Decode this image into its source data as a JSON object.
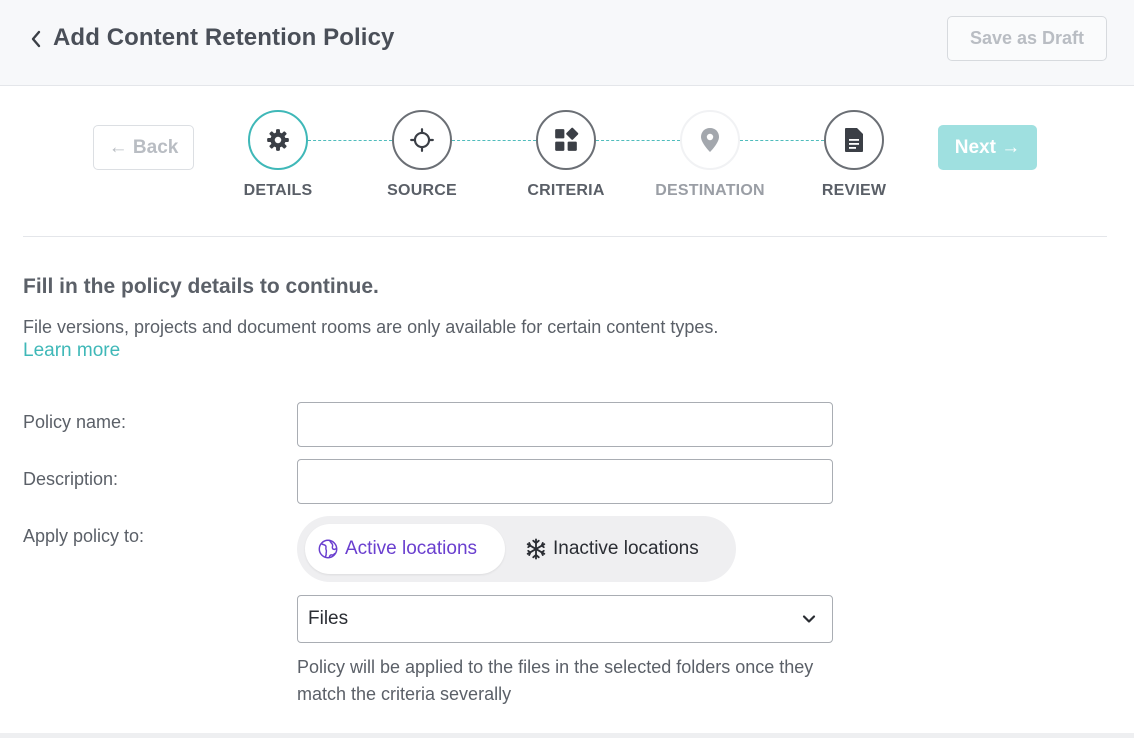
{
  "header": {
    "title": "Add Content Retention Policy",
    "save_draft_label": "Save as Draft"
  },
  "wizard": {
    "back_label": "← Back",
    "next_label": "Next →",
    "steps": [
      {
        "label": "DETAILS",
        "icon": "gear-icon",
        "state": "active"
      },
      {
        "label": "SOURCE",
        "icon": "crosshair-icon",
        "state": "default"
      },
      {
        "label": "CRITERIA",
        "icon": "grid-icon",
        "state": "default"
      },
      {
        "label": "DESTINATION",
        "icon": "location-pin-icon",
        "state": "disabled"
      },
      {
        "label": "REVIEW",
        "icon": "document-icon",
        "state": "default"
      }
    ]
  },
  "form": {
    "heading": "Fill in the policy details to continue.",
    "description": "File versions, projects and document rooms are only available for certain content types.",
    "learn_more": "Learn more",
    "policy_name_label": "Policy name:",
    "policy_name_value": "",
    "description_label": "Description:",
    "description_value": "",
    "apply_label": "Apply policy to:",
    "toggle": {
      "active_label": "Active locations",
      "inactive_label": "Inactive locations",
      "selected": "Active locations"
    },
    "content_type": {
      "selected": "Files"
    },
    "help_text": "Policy will be applied to the files in the selected folders once they match the criteria severally"
  },
  "colors": {
    "accent": "#3fb8b8",
    "next_button_bg": "#9fe0e0",
    "toggle_active_text": "#6a3fcf"
  }
}
